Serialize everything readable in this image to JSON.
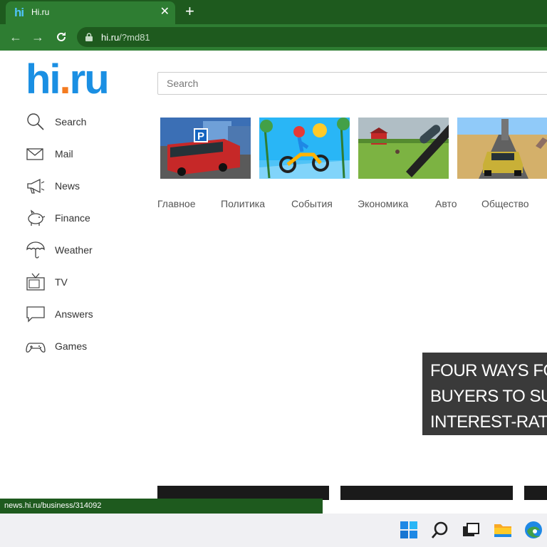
{
  "browser": {
    "tab_title": "Hi.ru",
    "tab_favicon": "hi",
    "url_host": "hi.ru",
    "url_path": "/?md81",
    "status_url": "news.hi.ru/business/314092"
  },
  "logo": {
    "part1": "hi",
    "dot": ".",
    "part2": "ru"
  },
  "search": {
    "placeholder": "Search"
  },
  "sidebar": {
    "items": [
      {
        "label": "Search",
        "icon": "search-icon"
      },
      {
        "label": "Mail",
        "icon": "mail-icon"
      },
      {
        "label": "News",
        "icon": "megaphone-icon"
      },
      {
        "label": "Finance",
        "icon": "piggy-bank-icon"
      },
      {
        "label": "Weather",
        "icon": "umbrella-icon"
      },
      {
        "label": "TV",
        "icon": "tv-icon"
      },
      {
        "label": "Answers",
        "icon": "chat-bubble-icon"
      },
      {
        "label": "Games",
        "icon": "gamepad-icon"
      }
    ]
  },
  "games": [
    {
      "name": "bus-parking-game-thumbnail"
    },
    {
      "name": "moto-x3m-game-thumbnail"
    },
    {
      "name": "sniper-game-thumbnail"
    },
    {
      "name": "car-driving-game-thumbnail"
    }
  ],
  "categories": [
    "Главное",
    "Политика",
    "События",
    "Экономика",
    "Авто",
    "Общество"
  ],
  "banner": {
    "lines": [
      "FOUR WAYS FO",
      "BUYERS TO SU",
      "INTEREST-RAT"
    ]
  },
  "colors": {
    "brand_blue": "#1a8fe3",
    "brand_orange": "#f47b20",
    "chrome_green": "#2e7d32",
    "chrome_dark_green": "#1e5a1e"
  }
}
